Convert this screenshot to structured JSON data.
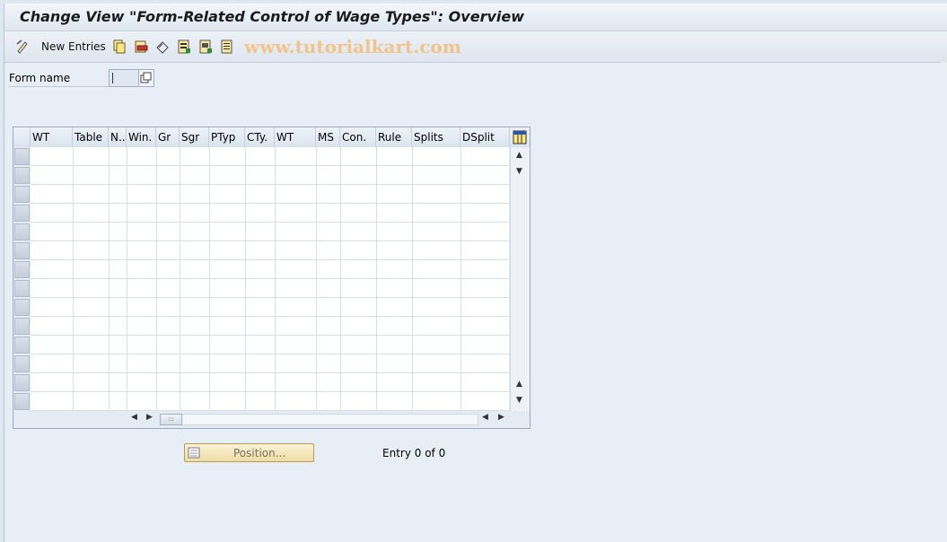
{
  "window": {
    "title": "Change View \"Form-Related Control of Wage Types\": Overview"
  },
  "toolbar": {
    "new_entries_label": "New Entries",
    "watermark": "www.tutorialkart.com",
    "icons": [
      "display-change-icon",
      "copy-icon",
      "delete-icon",
      "undo-icon",
      "select-all-icon",
      "select-block-icon",
      "deselect-all-icon"
    ]
  },
  "form": {
    "label": "Form name",
    "value": ""
  },
  "table": {
    "columns": [
      "WT",
      "Table",
      "N..",
      "Win.",
      "Gr",
      "Sgr",
      "PTyp",
      "CTy.",
      "WT",
      "MS",
      "Con.",
      "Rule",
      "Splits",
      "DSplit"
    ],
    "rows": []
  },
  "footer": {
    "position_label": "Position...",
    "entry_text": "Entry 0 of 0"
  },
  "colors": {
    "background": "#e8eef5",
    "header": "#dae3ed",
    "button": "#efdca4"
  }
}
